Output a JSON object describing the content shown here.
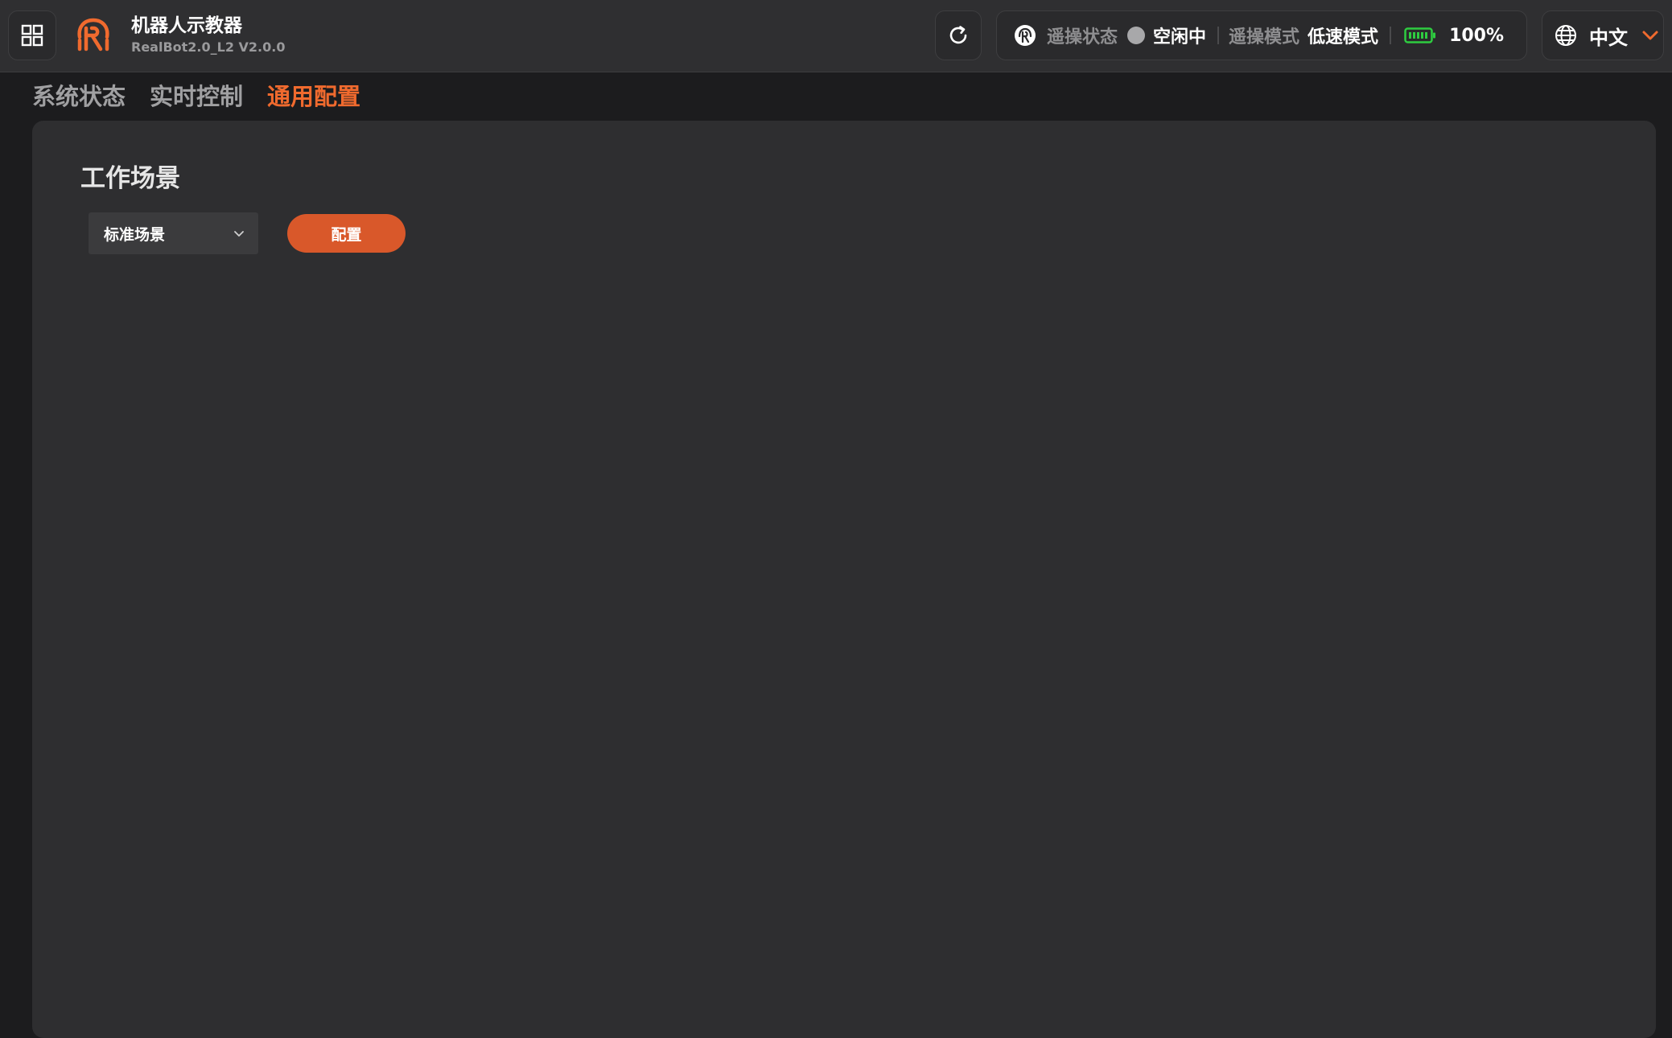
{
  "header": {
    "app_title": "机器人示教器",
    "app_version": "RealBot2.0_L2 V2.0.0",
    "teleop_status_label": "遥操状态",
    "teleop_status_value": "空闲中",
    "teleop_mode_label": "遥操模式",
    "teleop_mode_value": "低速模式",
    "battery_percent": "100%",
    "language": "中文"
  },
  "tabs": [
    {
      "label": "系统状态",
      "active": false
    },
    {
      "label": "实时控制",
      "active": false
    },
    {
      "label": "通用配置",
      "active": true
    }
  ],
  "main": {
    "section_title": "工作场景",
    "scene_select_value": "标准场景",
    "config_button_label": "配置"
  },
  "colors": {
    "accent": "#f06a2e",
    "button": "#d9582a",
    "battery": "#2ecc40",
    "status_dot": "#a8a8aa"
  },
  "icons": {
    "apps": "grid-icon",
    "logo": "robot-logo-icon",
    "refresh": "refresh-icon",
    "teleop": "robot-head-icon",
    "battery": "battery-full-icon",
    "language": "globe-icon",
    "dropdown": "chevron-down-icon"
  }
}
